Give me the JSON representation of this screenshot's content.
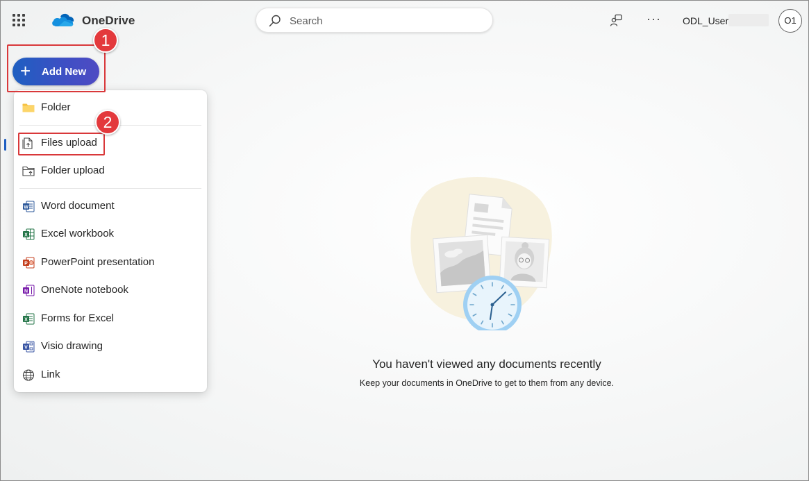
{
  "header": {
    "app_name": "OneDrive",
    "search_placeholder": "Search",
    "more_label": "···",
    "user_name": "ODL_User",
    "avatar_initials": "O1"
  },
  "add_new": {
    "label": "Add New",
    "plus": "+"
  },
  "callouts": [
    "1",
    "2"
  ],
  "menu": {
    "items": [
      {
        "label": "Folder",
        "icon": "folder-icon"
      },
      {
        "label": "Files upload",
        "icon": "file-upload-icon"
      },
      {
        "label": "Folder upload",
        "icon": "folder-upload-icon"
      },
      {
        "label": "Word document",
        "icon": "word-icon"
      },
      {
        "label": "Excel workbook",
        "icon": "excel-icon"
      },
      {
        "label": "PowerPoint presentation",
        "icon": "powerpoint-icon"
      },
      {
        "label": "OneNote notebook",
        "icon": "onenote-icon"
      },
      {
        "label": "Forms for Excel",
        "icon": "forms-excel-icon"
      },
      {
        "label": "Visio drawing",
        "icon": "visio-icon"
      },
      {
        "label": "Link",
        "icon": "globe-icon"
      }
    ]
  },
  "empty_state": {
    "title": "You haven't viewed any documents recently",
    "subtitle": "Keep your documents in OneDrive to get to them from any device."
  },
  "colors": {
    "accent": "#1f5fc2",
    "callout_red": "#e3393c",
    "word": "#2b579a",
    "excel": "#217346",
    "powerpoint": "#c43e1c",
    "onenote": "#7719aa",
    "visio": "#3955a3"
  }
}
